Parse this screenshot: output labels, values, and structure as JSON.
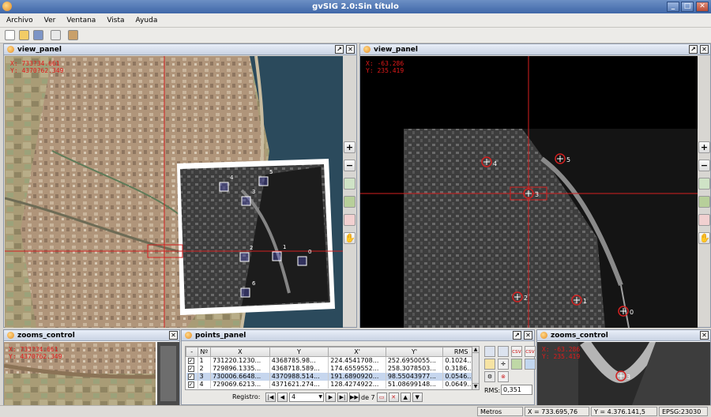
{
  "window": {
    "title": "gvSIG 2.0:Sin título",
    "min_label": "_",
    "max_label": "□",
    "close_label": "✕"
  },
  "menu": {
    "items": [
      "Archivo",
      "Ver",
      "Ventana",
      "Vista",
      "Ayuda"
    ]
  },
  "view_left": {
    "title": "view_panel",
    "coord_x": "X: 733?34.661",
    "coord_y": "Y: 4370?62.349",
    "markers": [
      "4",
      "5",
      "3",
      "2",
      "1",
      "0",
      "6"
    ]
  },
  "view_right": {
    "title": "view_panel",
    "coord_x": "X: -63.286",
    "coord_y": "Y: 235.419",
    "markers": [
      "4",
      "5",
      "3",
      "2",
      "1",
      "0"
    ]
  },
  "side_buttons": {
    "zoom_in": "+",
    "zoom_out": "−"
  },
  "zooms_left": {
    "title": "zooms_control",
    "coord_x": "X: 733?34.661",
    "coord_y": "Y: 4370?62.349"
  },
  "zooms_right": {
    "title": "zooms_control",
    "coord_x": "X: -63.286",
    "coord_y": "Y: 235.419",
    "marker": "3"
  },
  "points_panel": {
    "title": "points_panel",
    "columns": [
      "-",
      "Nº",
      "X",
      "Y",
      "X'",
      "Y'",
      "RMS"
    ],
    "rows": [
      {
        "n": "1",
        "x": "731220.1230...",
        "y": "4368785.98...",
        "xp": "224.4541708...",
        "yp": "252.6950055...",
        "rms": "0.1024...",
        "checked": true,
        "selected": false
      },
      {
        "n": "2",
        "x": "729896.1335...",
        "y": "4368718.589...",
        "xp": "174.6559552...",
        "yp": "258.3078503...",
        "rms": "0.3186...",
        "checked": true,
        "selected": false
      },
      {
        "n": "3",
        "x": "730006.6648...",
        "y": "4370988.514...",
        "xp": "191.6890920...",
        "yp": "98.55043977...",
        "rms": "0.0546...",
        "checked": true,
        "selected": true
      },
      {
        "n": "4",
        "x": "729069.6213...",
        "y": "4371621.274...",
        "xp": "128.4274922...",
        "yp": "51.08699148...",
        "rms": "0.0649...",
        "checked": true,
        "selected": false
      }
    ],
    "registro_label": "Registro:",
    "registro_value": "4",
    "de_label": "de 7",
    "rms_label": "RMS:",
    "rms_value": "0,351",
    "nav": {
      "first": "|◀",
      "prev": "◀",
      "next": "▶",
      "last": "▶|",
      "end": "▶▶|"
    }
  },
  "status": {
    "units": "Metros",
    "x": "X = 733.695,76",
    "y": "Y = 4.376.141,5",
    "epsg": "EPSG:23030"
  }
}
